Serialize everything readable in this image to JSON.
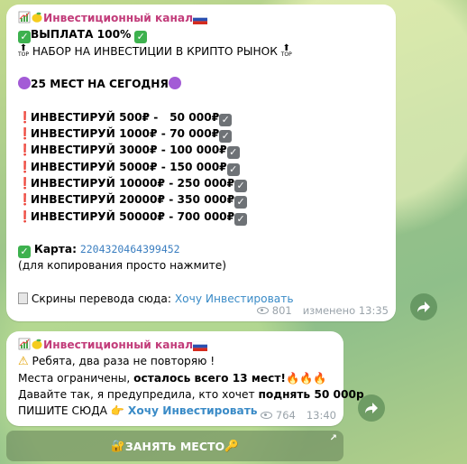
{
  "messages": [
    {
      "sender": "Инвестиционный канал",
      "payout": "ВЫПЛАТА 100%",
      "recruiting": "НАБОР НА ИНВЕСТИЦИИ В КРИПТО РЫНОК",
      "seats": "25 МЕСТ НА СЕГОДНЯ",
      "offers": [
        "ИНВЕСТИРУЙ 500₽ -   50 000₽",
        "ИНВЕСТИРУЙ 1000₽ - 70 000₽",
        "ИНВЕСТИРУЙ 3000₽ - 100 000₽",
        "ИНВЕСТИРУЙ 5000₽ - 150 000₽",
        "ИНВЕСТИРУЙ 10000₽ - 250 000₽",
        "ИНВЕСТИРУЙ 20000₽ - 350 000₽",
        "ИНВЕСТИРУЙ 50000₽ - 700 000₽"
      ],
      "card_label": "Карта:",
      "card_number": "2204320464399452",
      "copy_hint": "(для копирования просто нажмите)",
      "screens_text": "Скрины перевода сюда:",
      "screens_link": "Хочу Инвестировать",
      "views": "801",
      "time": "изменено 13:35"
    },
    {
      "sender": "Инвестиционный канал",
      "warning": "Ребята, два раза не повторяю !",
      "limited_prefix": "Места ограничены, ",
      "limited_bold": "осталось всего 13 мест!",
      "agree_prefix": "Давайте так, я предупредила, кто хочет ",
      "agree_bold": "поднять 50 000р",
      "write_text": "ПИШИТЕ СЮДА",
      "write_link": "Хочу Инвестировать",
      "views": "764",
      "time": "13:40"
    }
  ],
  "keyboard_button": "ЗАНЯТЬ МЕСТО",
  "colors": {
    "sender": "#c23c7a",
    "link": "#3a8bc7",
    "bubble": "#ffffff",
    "chat_background": "#9cc58a"
  },
  "icons": [
    "chart-icon",
    "lemon-icon",
    "russia-flag-icon",
    "check-mark-icon",
    "top-arrow-icon",
    "purple-circle-icon",
    "exclamation-icon",
    "ballot-check-icon",
    "document-icon",
    "eye-icon",
    "warning-icon",
    "fire-icon",
    "pointing-hand-icon",
    "lock-key-icon",
    "key-icon",
    "forward-icon",
    "external-link-icon"
  ]
}
